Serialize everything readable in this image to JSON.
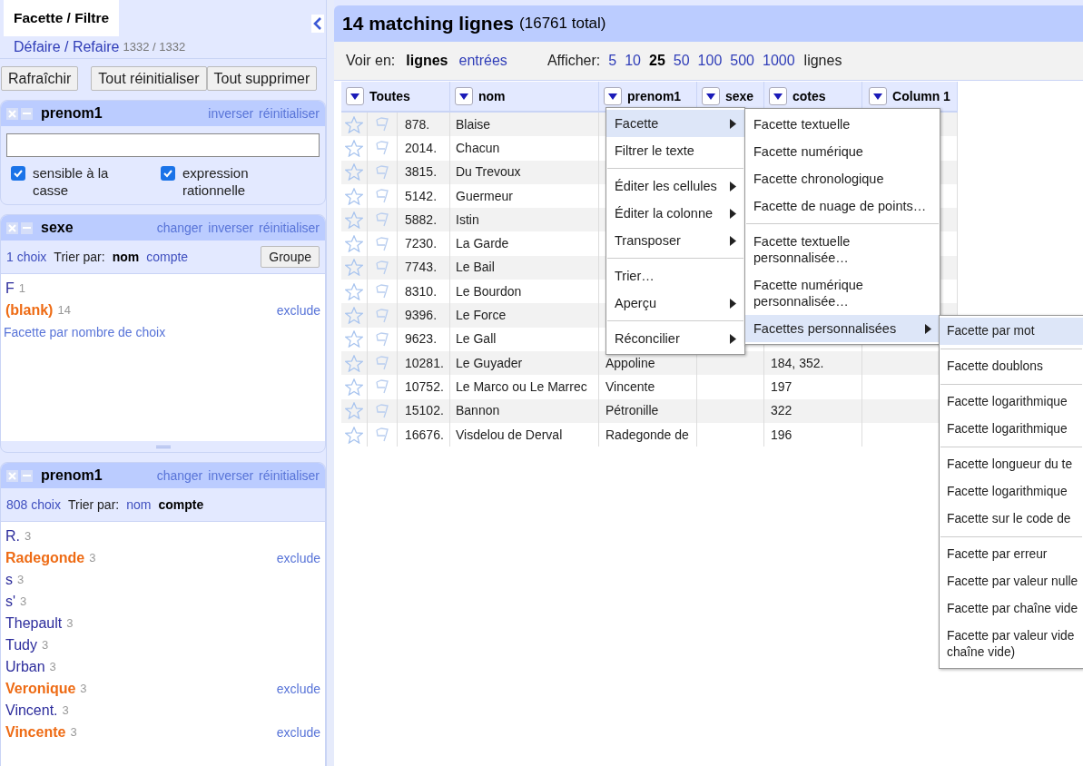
{
  "left_panel": {
    "tab": {
      "label": "Facette / Filtre",
      "selected": true
    },
    "undo": {
      "label": "Défaire / Refaire",
      "count": "1332 / 1332"
    },
    "buttons": [
      "Rafraîchir",
      "Tout réinitialiser",
      "Tout supprimer"
    ],
    "facets": [
      {
        "kind": "text",
        "title": "prenom1",
        "actions": [
          "inverser",
          "réinitialiser"
        ],
        "checkboxes": [
          {
            "label": "sensible à la casse",
            "checked": true
          },
          {
            "label": "expression rationnelle",
            "checked": true
          }
        ]
      },
      {
        "kind": "list",
        "title": "sexe",
        "actions": [
          "changer",
          "inverser",
          "réinitialiser"
        ],
        "choices": "1 choix",
        "sort_label": "Trier par:",
        "sort_options": [
          {
            "label": "nom",
            "selected": true
          },
          {
            "label": "compte",
            "selected": false
          }
        ],
        "group_button": "Groupe",
        "items": [
          {
            "name": "F",
            "count": "1",
            "selected": false
          },
          {
            "name": "(blank)",
            "count": "14",
            "selected": true,
            "action": "exclude"
          }
        ],
        "footer_link": "Facette par nombre de choix"
      },
      {
        "kind": "list",
        "title": "prenom1",
        "actions": [
          "changer",
          "inverser",
          "réinitialiser"
        ],
        "choices": "808 choix",
        "sort_label": "Trier par:",
        "sort_options": [
          {
            "label": "nom",
            "selected": false
          },
          {
            "label": "compte",
            "selected": true
          }
        ],
        "items": [
          {
            "name": "R.",
            "count": "3",
            "selected": false
          },
          {
            "name": "Radegonde",
            "count": "3",
            "selected": true,
            "action": "exclude"
          },
          {
            "name": "s",
            "count": "3",
            "selected": false
          },
          {
            "name": "s'",
            "count": "3",
            "selected": false
          },
          {
            "name": "Thepault",
            "count": "3",
            "selected": false
          },
          {
            "name": "Tudy",
            "count": "3",
            "selected": false
          },
          {
            "name": "Urban",
            "count": "3",
            "selected": false
          },
          {
            "name": "Veronique",
            "count": "3",
            "selected": true,
            "action": "exclude"
          },
          {
            "name": "Vincent.",
            "count": "3",
            "selected": false
          },
          {
            "name": "Vincente",
            "count": "3",
            "selected": true,
            "action": "exclude"
          }
        ]
      }
    ]
  },
  "header": {
    "title": "14 matching lignes",
    "total": "(16761 total)"
  },
  "toolbar": {
    "view_label": "Voir en:",
    "view_options": [
      {
        "label": "lignes",
        "selected": true
      },
      {
        "label": "entrées",
        "selected": false
      }
    ],
    "show_label": "Afficher:",
    "page_sizes": [
      {
        "label": "5",
        "selected": false
      },
      {
        "label": "10",
        "selected": false
      },
      {
        "label": "25",
        "selected": true
      },
      {
        "label": "50",
        "selected": false
      },
      {
        "label": "100",
        "selected": false
      },
      {
        "label": "500",
        "selected": false
      },
      {
        "label": "1000",
        "selected": false
      }
    ],
    "unit": "lignes"
  },
  "table": {
    "columns": [
      "Toutes",
      "nom",
      "prenom1",
      "sexe",
      "cotes",
      "Column 1"
    ],
    "rows": [
      {
        "index": "878.",
        "nom": "Blaise"
      },
      {
        "index": "2014.",
        "nom": "Chacun"
      },
      {
        "index": "3815.",
        "nom": "Du Trevoux"
      },
      {
        "index": "5142.",
        "nom": "Guermeur"
      },
      {
        "index": "5882.",
        "nom": "Istin"
      },
      {
        "index": "7230.",
        "nom": "La Garde"
      },
      {
        "index": "7743.",
        "nom": "Le Bail"
      },
      {
        "index": "8310.",
        "nom": "Le Bourdon"
      },
      {
        "index": "9396.",
        "nom": "Le Force"
      },
      {
        "index": "9623.",
        "nom": "Le Gall"
      },
      {
        "index": "10281.",
        "nom": "Le Guyader",
        "prenom1": "Appoline",
        "cotes": "184, 352."
      },
      {
        "index": "10752.",
        "nom": "Le Marco ou Le Marrec",
        "prenom1": "Vincente",
        "cotes": "197"
      },
      {
        "index": "15102.",
        "nom": "Bannon",
        "prenom1": "Pétronille",
        "cotes": "322"
      },
      {
        "index": "16676.",
        "nom": "Visdelou de Derval",
        "prenom1": "Radegonde de",
        "cotes": "196"
      }
    ]
  },
  "menus": [
    {
      "items": [
        {
          "kind": "item",
          "label": "Facette",
          "submenu": true,
          "selected": true
        },
        {
          "kind": "item",
          "label": "Filtrer le texte",
          "submenu": false,
          "selected": false
        },
        {
          "kind": "separator"
        },
        {
          "kind": "item",
          "label": "Éditer les cellules",
          "submenu": true,
          "selected": false
        },
        {
          "kind": "item",
          "label": "Éditer la colonne",
          "submenu": true,
          "selected": false
        },
        {
          "kind": "item",
          "label": "Transposer",
          "submenu": true,
          "selected": false
        },
        {
          "kind": "separator"
        },
        {
          "kind": "item",
          "label": "Trier…",
          "submenu": false,
          "selected": false
        },
        {
          "kind": "item",
          "label": "Aperçu",
          "submenu": true,
          "selected": false
        },
        {
          "kind": "separator"
        },
        {
          "kind": "item",
          "label": "Réconcilier",
          "submenu": true,
          "selected": false
        }
      ]
    },
    {
      "items": [
        {
          "kind": "item",
          "label": "Facette textuelle",
          "submenu": false,
          "selected": false
        },
        {
          "kind": "item",
          "label": "Facette numérique",
          "submenu": false,
          "selected": false
        },
        {
          "kind": "item",
          "label": "Facette chronologique",
          "submenu": false,
          "selected": false
        },
        {
          "kind": "item",
          "label": "Facette de nuage de points…",
          "submenu": false,
          "selected": false
        },
        {
          "kind": "separator"
        },
        {
          "kind": "item",
          "label": "Facette textuelle personnalisée…",
          "submenu": false,
          "selected": false
        },
        {
          "kind": "item",
          "label": "Facette numérique personnalisée…",
          "submenu": false,
          "selected": false
        },
        {
          "kind": "item",
          "label": "Facettes personnalisées",
          "submenu": true,
          "selected": true
        }
      ]
    },
    {
      "items": [
        {
          "kind": "item",
          "label": "Facette par mot",
          "submenu": false,
          "selected": true
        },
        {
          "kind": "separator"
        },
        {
          "kind": "item",
          "label": "Facette doublons",
          "submenu": false,
          "selected": false
        },
        {
          "kind": "separator"
        },
        {
          "kind": "item",
          "label": "Facette logarithmique",
          "submenu": false,
          "selected": false
        },
        {
          "kind": "item",
          "label": "Facette logarithmique",
          "submenu": false,
          "selected": false
        },
        {
          "kind": "separator"
        },
        {
          "kind": "item",
          "label": "Facette longueur du te",
          "submenu": false,
          "selected": false
        },
        {
          "kind": "item",
          "label": "Facette logarithmique",
          "submenu": false,
          "selected": false
        },
        {
          "kind": "item",
          "label": "Facette sur le code de",
          "submenu": false,
          "selected": false
        },
        {
          "kind": "separator"
        },
        {
          "kind": "item",
          "label": "Facette par erreur",
          "submenu": false,
          "selected": false
        },
        {
          "kind": "item",
          "label": "Facette par valeur nulle",
          "submenu": false,
          "selected": false
        },
        {
          "kind": "item",
          "label": "Facette par chaîne vide",
          "submenu": false,
          "selected": false
        },
        {
          "kind": "item",
          "label": "Facette par valeur vide",
          "label2": "chaîne vide)",
          "submenu": false,
          "selected": false
        }
      ]
    }
  ]
}
